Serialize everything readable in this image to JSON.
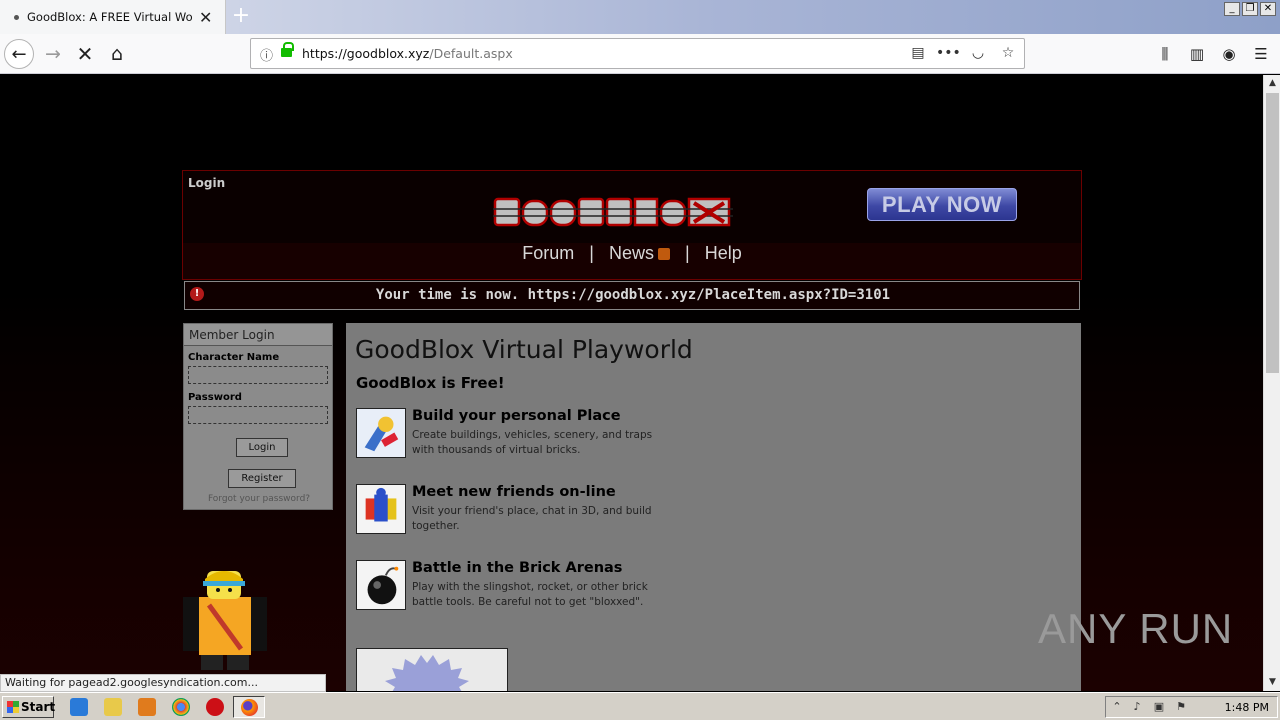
{
  "browser": {
    "tab_title": "GoodBlox: A FREE Virtual World-Bu",
    "url_host": "https://goodblox.xyz",
    "url_path": "/Default.aspx",
    "status_text": "Waiting for pagead2.googlesyndication.com..."
  },
  "page": {
    "login_link": "Login",
    "play_now": "PLAY NOW",
    "nav": {
      "forum": "Forum",
      "news": "News",
      "help": "Help",
      "separator": "|"
    },
    "alert_message": "Your time is now. https://goodblox.xyz/PlaceItem.aspx?ID=3101",
    "member_login": {
      "heading": "Member Login",
      "character_name_label": "Character Name",
      "password_label": "Password",
      "login_button": "Login",
      "register_button": "Register",
      "forgot_link": "Forgot your password?"
    },
    "main": {
      "title": "GoodBlox Virtual Playworld",
      "subtitle": "GoodBlox is Free!",
      "features": [
        {
          "title": "Build your personal Place",
          "desc": "Create buildings, vehicles, scenery, and traps with thousands of virtual bricks.",
          "icon": "build-tools-icon"
        },
        {
          "title": "Meet new friends on-line",
          "desc": "Visit your friend's place, chat in 3D, and build together.",
          "icon": "friends-icon"
        },
        {
          "title": "Battle in the Brick Arenas",
          "desc": "Play with the slingshot, rocket, or other brick battle tools. Be careful not to get \"bloxxed\".",
          "icon": "bomb-icon"
        }
      ]
    }
  },
  "watermark": "ANY RUN",
  "taskbar": {
    "start_label": "Start",
    "clock": "1:48 PM"
  },
  "colors": {
    "page_bg": "#000000",
    "header_border": "#6b0000",
    "panel_gray": "#7b7b7b",
    "play_now_blue": "#3e48a5"
  }
}
